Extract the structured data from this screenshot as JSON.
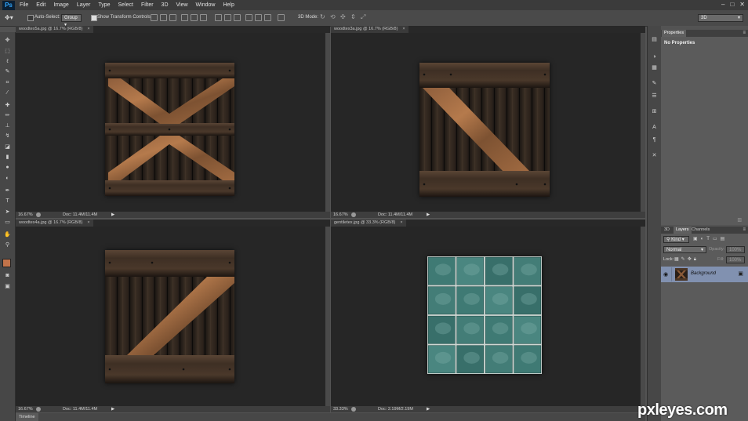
{
  "app": {
    "logo": "Ps"
  },
  "menu": [
    "File",
    "Edit",
    "Image",
    "Layer",
    "Type",
    "Select",
    "Filter",
    "3D",
    "View",
    "Window",
    "Help"
  ],
  "window_controls": {
    "minimize": "–",
    "maximize": "□",
    "close": "✕"
  },
  "options_bar": {
    "auto_select_label": "Auto-Select:",
    "auto_select_value": "Group",
    "show_transform_label": "Show Transform Controls",
    "mode_3d_label": "3D Mode:",
    "workspace_value": "3D"
  },
  "documents": [
    {
      "title": "woodtex5a.jpg @ 16.7% (RGB/8)",
      "zoom": "16.67%",
      "doc_info": "Doc: 11.4M/11.4M",
      "image": "crate-x"
    },
    {
      "title": "woodtex3a.jpg @ 16.7% (RGB/8)",
      "zoom": "16.67%",
      "doc_info": "Doc: 11.4M/11.4M",
      "image": "crate-diag-down"
    },
    {
      "title": "woodtex4a.jpg @ 16.7% (RGB/8)",
      "zoom": "16.67%",
      "doc_info": "Doc: 11.4M/11.4M",
      "image": "crate-diag-up"
    },
    {
      "title": "gentiletex.jpg @ 33.3% (RGB/8)",
      "zoom": "33.33%",
      "doc_info": "Doc: 2.19M/2.19M",
      "image": "tiles"
    }
  ],
  "timeline_label": "Timeline",
  "properties_panel": {
    "tab": "Properties",
    "body": "No Properties"
  },
  "layers_panel": {
    "tabs": [
      "3D",
      "Layers",
      "Channels"
    ],
    "active_tab": "Layers",
    "filter_label": "Kind",
    "blend_mode": "Normal",
    "opacity_label": "Opacity:",
    "opacity_value": "100%",
    "lock_label": "Lock:",
    "fill_label": "Fill:",
    "fill_value": "100%",
    "layers": [
      {
        "name": "Background",
        "locked": true,
        "visible": true
      }
    ]
  },
  "watermark": "pxleyes.com",
  "colors": {
    "foreground": "#c2734a",
    "background": "#ffffff",
    "accent": "#31a8ff"
  }
}
